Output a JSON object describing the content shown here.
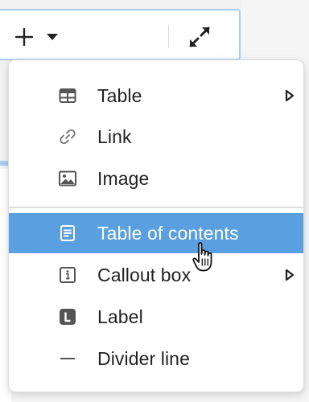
{
  "toolbar": {
    "icons": {
      "insert": "plus-icon",
      "dropdown": "caret-down-icon",
      "fullscreen": "expand-icon"
    }
  },
  "menu": {
    "items": [
      {
        "label": "Table",
        "icon": "table-icon",
        "has_submenu": true
      },
      {
        "label": "Link",
        "icon": "link-icon",
        "has_submenu": false
      },
      {
        "label": "Image",
        "icon": "image-icon",
        "has_submenu": false
      },
      {
        "label": "Table of contents",
        "icon": "table-of-contents-icon",
        "has_submenu": false,
        "highlighted": true
      },
      {
        "label": "Callout box",
        "icon": "info-box-icon",
        "has_submenu": true
      },
      {
        "label": "Label",
        "icon": "label-icon",
        "has_submenu": false
      },
      {
        "label": "Divider line",
        "icon": "divider-line-icon",
        "has_submenu": false
      }
    ]
  },
  "colors": {
    "highlight": "#5aa0e0",
    "toolbar_border": "#a8cdf0",
    "text": "#222222",
    "icon": "#555555"
  }
}
